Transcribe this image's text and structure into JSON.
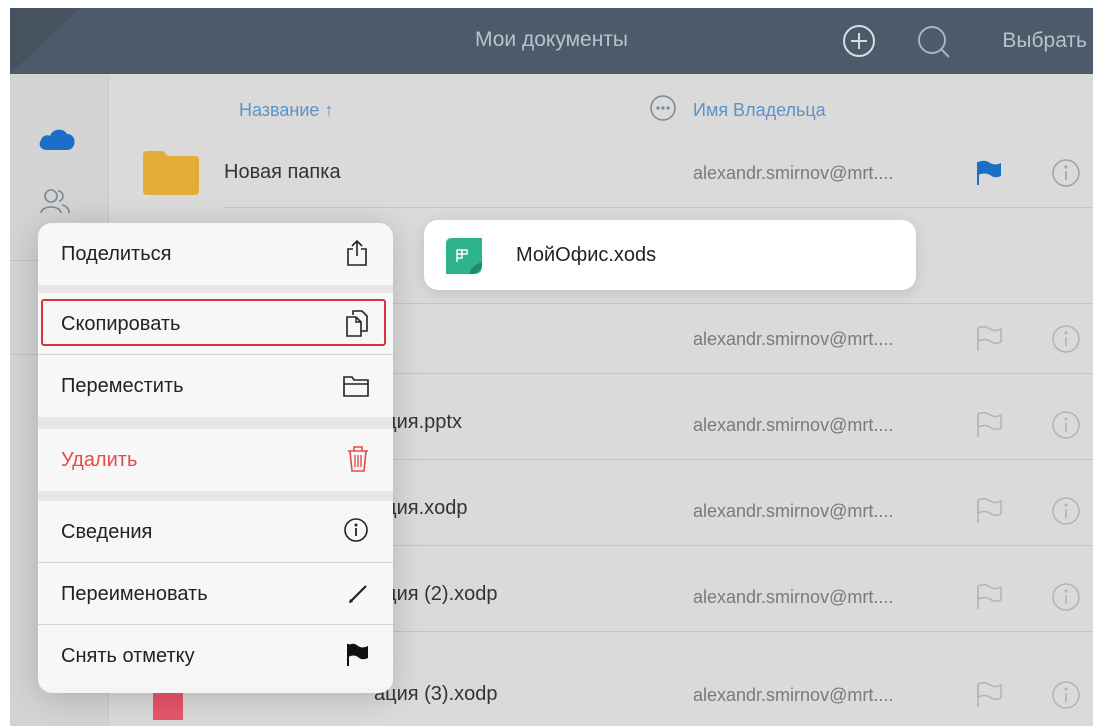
{
  "header": {
    "title": "Мои документы",
    "select_label": "Выбрать",
    "add_icon": "plus-circle-icon",
    "search_icon": "search-icon"
  },
  "sidebar": {
    "items": [
      {
        "icon": "cloud-icon",
        "active": true
      },
      {
        "icon": "users-icon",
        "active": false
      }
    ]
  },
  "columns": {
    "name": "Название ↑",
    "more_icon": "ellipsis-circle-icon",
    "owner": "Имя Владельца"
  },
  "files": [
    {
      "name": "Новая папка",
      "owner": "alexandr.smirnov@mrt....",
      "type": "folder",
      "flagged": true
    },
    {
      "name": "",
      "owner": "",
      "type": "hidden"
    },
    {
      "name": "",
      "owner": "alexandr.smirnov@mrt....",
      "type": "file",
      "flagged": false
    },
    {
      "name": "ация.pptx",
      "owner": "alexandr.smirnov@mrt....",
      "type": "file",
      "flagged": false
    },
    {
      "name": "ация.xodp",
      "owner": "alexandr.smirnov@mrt....",
      "type": "file",
      "flagged": false
    },
    {
      "name": "ация (2).xodp",
      "owner": "alexandr.smirnov@mrt....",
      "type": "file",
      "flagged": false
    },
    {
      "name": "ация (3).xodp",
      "owner": "alexandr.smirnov@mrt....",
      "type": "file",
      "flagged": false
    }
  ],
  "preview": {
    "file_name": "МойОфис.xods",
    "icon": "spreadsheet-file-icon"
  },
  "context_menu": {
    "items": [
      {
        "label": "Поделиться",
        "icon": "share-icon"
      },
      {
        "label": "Скопировать",
        "icon": "copy-icon",
        "highlighted": true
      },
      {
        "label": "Переместить",
        "icon": "folder-icon"
      },
      {
        "label": "Удалить",
        "icon": "trash-icon",
        "destructive": true
      },
      {
        "label": "Сведения",
        "icon": "info-icon"
      },
      {
        "label": "Переименовать",
        "icon": "pencil-icon"
      },
      {
        "label": "Снять отметку",
        "icon": "flag-icon"
      }
    ]
  },
  "colors": {
    "header_bg": "#4d5a69",
    "accent_blue": "#1b6fc7",
    "danger_red": "#e24c4c",
    "highlight_red": "#d9343d",
    "folder_yellow": "#e6ac3a",
    "xods_green": "#2fb38e"
  }
}
